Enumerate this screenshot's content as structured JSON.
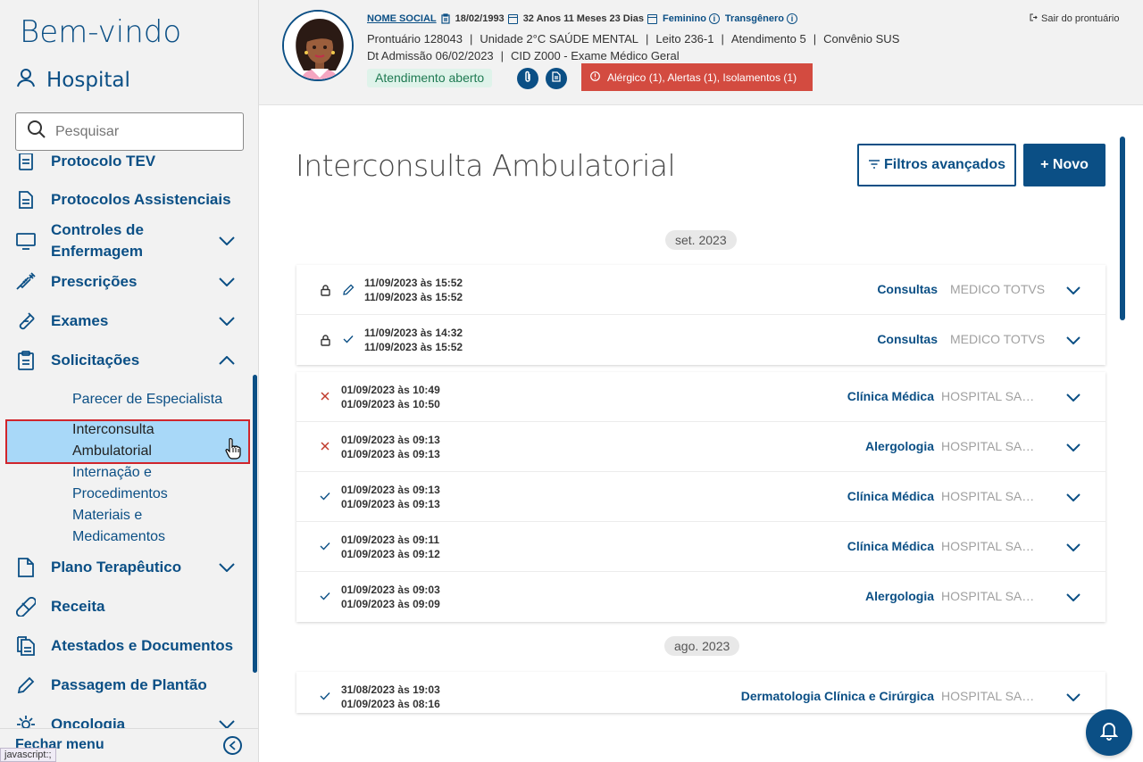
{
  "sidebar": {
    "welcome": "Bem-vindo",
    "hospital": "Hospital",
    "search_placeholder": "Pesquisar",
    "items": [
      {
        "label": "Protocolo TEV",
        "icon": "document-icon"
      },
      {
        "label": "Protocolos Assistenciais",
        "icon": "document-icon"
      },
      {
        "label": "Controles de Enfermagem",
        "icon": "monitor-icon",
        "expandable": true
      },
      {
        "label": "Prescrições",
        "icon": "syringe-icon",
        "expandable": true
      },
      {
        "label": "Exames",
        "icon": "test-tube-icon",
        "expandable": true
      },
      {
        "label": "Solicitações",
        "icon": "clipboard-icon",
        "expandable": true,
        "expanded": true
      },
      {
        "label": "Plano Terapêutico",
        "icon": "file-icon",
        "expandable": true
      },
      {
        "label": "Receita",
        "icon": "pill-icon"
      },
      {
        "label": "Atestados e Documentos",
        "icon": "documents-icon"
      },
      {
        "label": "Passagem de Plantão",
        "icon": "pencil-icon"
      },
      {
        "label": "Oncologia",
        "icon": "gear-icon",
        "expandable": true
      }
    ],
    "subitems": [
      {
        "label": "Parecer de Especialista"
      },
      {
        "label": "Interconsulta Ambulatorial",
        "active": true
      },
      {
        "label": "Internação e Procedimentos"
      },
      {
        "label": "Materiais e Medicamentos"
      }
    ],
    "close_menu": "Fechar menu",
    "status_tip": "javascript:;"
  },
  "patient": {
    "social_name": "NOME SOCIAL",
    "birth_date": "18/02/1993",
    "age": "32 Anos 11 Meses 23 Dias",
    "gender": "Feminino",
    "identity": "Transgênero",
    "line2": {
      "prontuario": "Prontuário 128043",
      "unidade": "Unidade 2°C SAÚDE MENTAL",
      "leito": "Leito 236-1",
      "atendimento": "Atendimento 5",
      "convenio": "Convênio SUS"
    },
    "line3": {
      "admissao": "Dt Admissão 06/02/2023",
      "cid": "CID Z000 - Exame Médico Geral"
    },
    "status_badge": "Atendimento aberto",
    "alerts": "Alérgico (1),  Alertas (1),  Isolamentos (1)",
    "exit_label": "Sair do prontuário"
  },
  "main": {
    "title": "Interconsulta Ambulatorial",
    "filter_button": "Filtros avançados",
    "new_button": "+ Novo",
    "groups": [
      {
        "month": "set. 2023",
        "cards": [
          {
            "rows": [
              {
                "start": "11/09/2023 às 15:52",
                "end": "11/09/2023 às 15:52",
                "status": "locked-edit",
                "specialty": "Consultas",
                "professional": "MEDICO TOTVS"
              },
              {
                "start": "11/09/2023 às 14:32",
                "end": "11/09/2023 às 15:52",
                "status": "locked-done",
                "specialty": "Consultas",
                "professional": "MEDICO TOTVS"
              }
            ]
          },
          {
            "rows": [
              {
                "start": "01/09/2023 às 10:49",
                "end": "01/09/2023 às 10:50",
                "status": "cancelled",
                "specialty": "Clínica Médica",
                "professional": "HOSPITAL SAN..."
              },
              {
                "start": "01/09/2023 às 09:13",
                "end": "01/09/2023 às 09:13",
                "status": "cancelled",
                "specialty": "Alergologia",
                "professional": "HOSPITAL SAN..."
              },
              {
                "start": "01/09/2023 às 09:13",
                "end": "01/09/2023 às 09:13",
                "status": "done",
                "specialty": "Clínica Médica",
                "professional": "HOSPITAL SAN..."
              },
              {
                "start": "01/09/2023 às 09:11",
                "end": "01/09/2023 às 09:12",
                "status": "done",
                "specialty": "Clínica Médica",
                "professional": "HOSPITAL SAN..."
              },
              {
                "start": "01/09/2023 às 09:03",
                "end": "01/09/2023 às 09:09",
                "status": "done",
                "specialty": "Alergologia",
                "professional": "HOSPITAL SAN..."
              }
            ]
          }
        ]
      },
      {
        "month": "ago. 2023",
        "cards": [
          {
            "rows": [
              {
                "start": "31/08/2023 às 19:03",
                "end": "01/09/2023 às 08:16",
                "status": "done",
                "specialty": "Dermatologia Clínica e Cirúrgica",
                "professional": "HOSPITAL SAN..."
              }
            ]
          }
        ]
      }
    ]
  },
  "colors": {
    "primary": "#0b4f85",
    "alert": "#d34b40",
    "open_badge_bg": "#dff3ea",
    "active_item_bg": "#a8d8f8"
  }
}
